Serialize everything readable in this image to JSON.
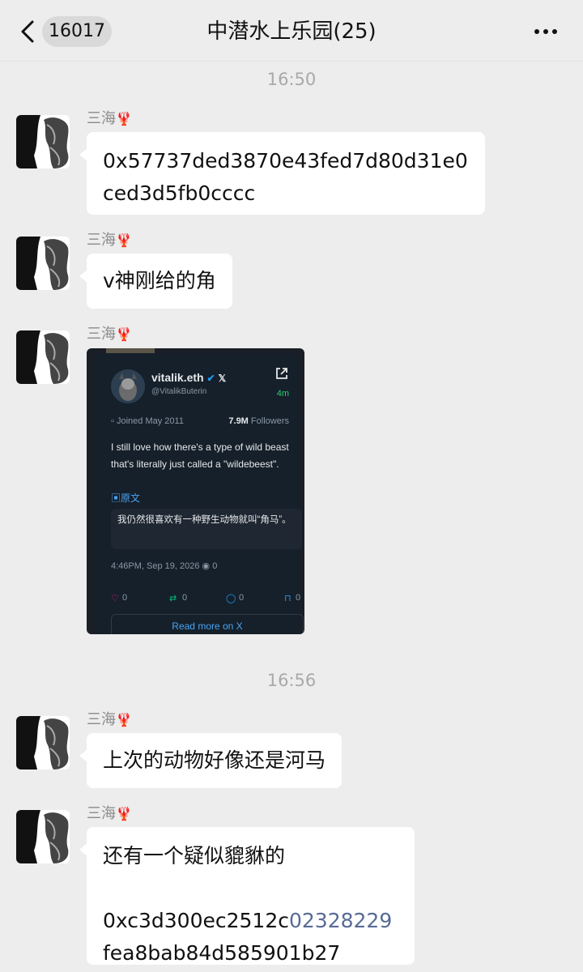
{
  "header": {
    "unread_count": "16017",
    "title": "中潜水上乐园(25)"
  },
  "messages": [
    {
      "timestamp": "16:50"
    },
    {
      "sender": "三海",
      "text": "0x57737ded3870e43fed7d80d31e0ced3d5fb0cccc"
    },
    {
      "sender": "三海",
      "text": "v神刚给的角"
    },
    {
      "sender": "三海",
      "type": "image"
    },
    {
      "timestamp": "16:56"
    },
    {
      "sender": "三海",
      "text": "上次的动物好像还是河马"
    },
    {
      "sender": "三海",
      "text_line1": "还有一个疑似貔貅的",
      "text_addr_a": "0xc3d300ec2512c",
      "text_addr_link": "02328229",
      "text_addr_b": "fea8bab84d585901b27"
    }
  ],
  "sender_emoji": "🦞",
  "tweet_card": {
    "name": "vitalik.eth",
    "handle": "@VitalikButerin",
    "time_ago": "4m",
    "joined": "Joined May 2011",
    "followers_count": "7.9M",
    "followers_label": "Followers",
    "text": "I still love how there's a type of wild beast that's literally just called a \"wildebeest\".",
    "original_label": "原文",
    "translation": "我仍然很喜欢有一种野生动物就叫“角马”。",
    "datetime": "4:46PM, Sep 19, 2026",
    "views": "0",
    "likes": "0",
    "retweets": "0",
    "replies": "0",
    "bookmarks": "0",
    "read_more": "Read more on X"
  },
  "colors": {
    "background": "#ededed",
    "bubble": "#ffffff",
    "link": "#576b95"
  }
}
